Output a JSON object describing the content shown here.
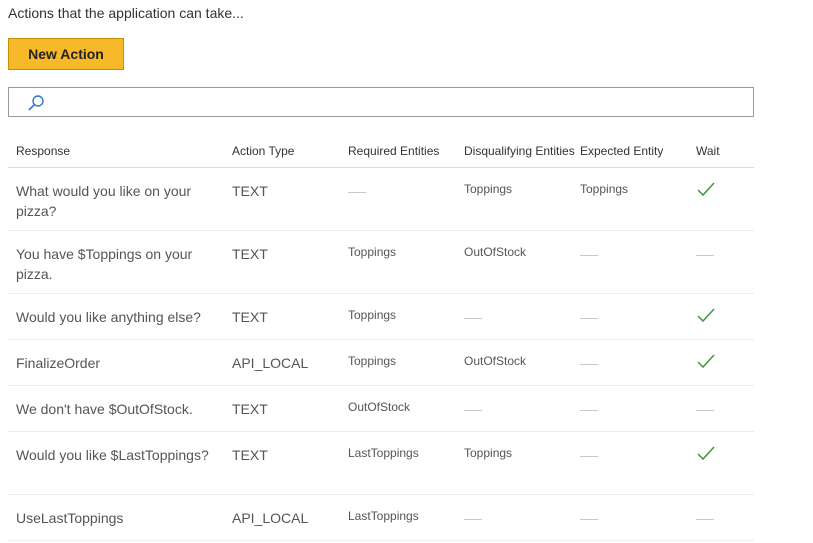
{
  "page": {
    "subtitle": "Actions that the application can take...",
    "new_action_label": "New Action",
    "search_placeholder": ""
  },
  "table": {
    "columns": [
      "Response",
      "Action Type",
      "Required Entities",
      "Disqualifying Entities",
      "Expected Entity",
      "Wait"
    ],
    "rows": [
      {
        "response": "What would you like on your pizza?",
        "action_type": "TEXT",
        "required": "",
        "disqualifying": "Toppings",
        "expected": "Toppings",
        "wait": true
      },
      {
        "response": "You have $Toppings on your pizza.",
        "action_type": "TEXT",
        "required": "Toppings",
        "disqualifying": "OutOfStock",
        "expected": "",
        "wait": false
      },
      {
        "response": "Would you like anything else?",
        "action_type": "TEXT",
        "required": "Toppings",
        "disqualifying": "",
        "expected": "",
        "wait": true
      },
      {
        "response": "FinalizeOrder",
        "action_type": "API_LOCAL",
        "required": "Toppings",
        "disqualifying": "OutOfStock",
        "expected": "",
        "wait": true
      },
      {
        "response": "We don't have $OutOfStock.",
        "action_type": "TEXT",
        "required": "OutOfStock",
        "disqualifying": "",
        "expected": "",
        "wait": false
      },
      {
        "response": "Would you like $LastToppings?",
        "action_type": "TEXT",
        "required": "LastToppings",
        "disqualifying": "Toppings",
        "expected": "",
        "wait": true
      },
      {
        "response": "UseLastToppings",
        "action_type": "API_LOCAL",
        "required": "LastToppings",
        "disqualifying": "",
        "expected": "",
        "wait": false
      }
    ]
  },
  "colors": {
    "button_bg": "#f7b82a",
    "check": "#3c9a3c",
    "search_icon": "#2b7bd1"
  },
  "icons": {
    "search": "search-icon",
    "wait_true": "checkmark-icon",
    "empty": "dash-icon"
  }
}
